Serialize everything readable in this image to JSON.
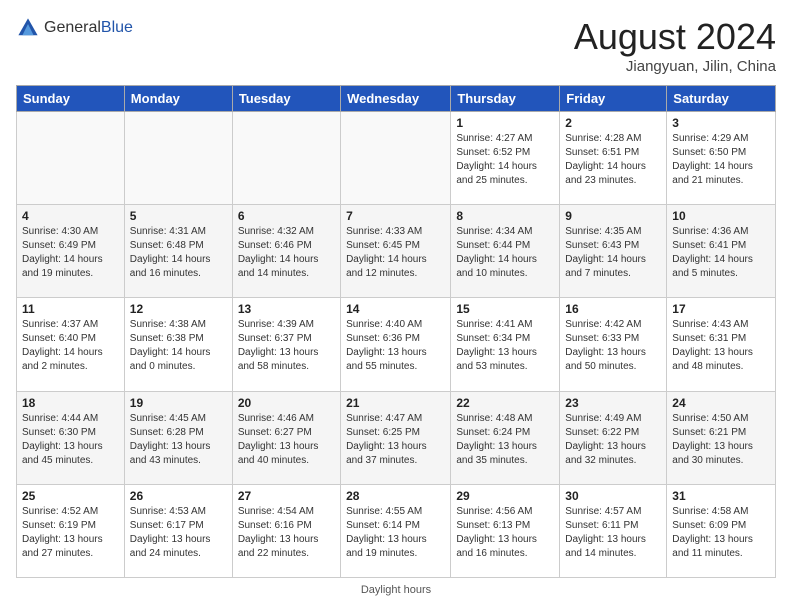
{
  "header": {
    "logo_general": "General",
    "logo_blue": "Blue",
    "title": "August 2024",
    "subtitle": "Jiangyuan, Jilin, China"
  },
  "days_of_week": [
    "Sunday",
    "Monday",
    "Tuesday",
    "Wednesday",
    "Thursday",
    "Friday",
    "Saturday"
  ],
  "weeks": [
    [
      {
        "day": "",
        "info": ""
      },
      {
        "day": "",
        "info": ""
      },
      {
        "day": "",
        "info": ""
      },
      {
        "day": "",
        "info": ""
      },
      {
        "day": "1",
        "info": "Sunrise: 4:27 AM\nSunset: 6:52 PM\nDaylight: 14 hours and 25 minutes."
      },
      {
        "day": "2",
        "info": "Sunrise: 4:28 AM\nSunset: 6:51 PM\nDaylight: 14 hours and 23 minutes."
      },
      {
        "day": "3",
        "info": "Sunrise: 4:29 AM\nSunset: 6:50 PM\nDaylight: 14 hours and 21 minutes."
      }
    ],
    [
      {
        "day": "4",
        "info": "Sunrise: 4:30 AM\nSunset: 6:49 PM\nDaylight: 14 hours and 19 minutes."
      },
      {
        "day": "5",
        "info": "Sunrise: 4:31 AM\nSunset: 6:48 PM\nDaylight: 14 hours and 16 minutes."
      },
      {
        "day": "6",
        "info": "Sunrise: 4:32 AM\nSunset: 6:46 PM\nDaylight: 14 hours and 14 minutes."
      },
      {
        "day": "7",
        "info": "Sunrise: 4:33 AM\nSunset: 6:45 PM\nDaylight: 14 hours and 12 minutes."
      },
      {
        "day": "8",
        "info": "Sunrise: 4:34 AM\nSunset: 6:44 PM\nDaylight: 14 hours and 10 minutes."
      },
      {
        "day": "9",
        "info": "Sunrise: 4:35 AM\nSunset: 6:43 PM\nDaylight: 14 hours and 7 minutes."
      },
      {
        "day": "10",
        "info": "Sunrise: 4:36 AM\nSunset: 6:41 PM\nDaylight: 14 hours and 5 minutes."
      }
    ],
    [
      {
        "day": "11",
        "info": "Sunrise: 4:37 AM\nSunset: 6:40 PM\nDaylight: 14 hours and 2 minutes."
      },
      {
        "day": "12",
        "info": "Sunrise: 4:38 AM\nSunset: 6:38 PM\nDaylight: 14 hours and 0 minutes."
      },
      {
        "day": "13",
        "info": "Sunrise: 4:39 AM\nSunset: 6:37 PM\nDaylight: 13 hours and 58 minutes."
      },
      {
        "day": "14",
        "info": "Sunrise: 4:40 AM\nSunset: 6:36 PM\nDaylight: 13 hours and 55 minutes."
      },
      {
        "day": "15",
        "info": "Sunrise: 4:41 AM\nSunset: 6:34 PM\nDaylight: 13 hours and 53 minutes."
      },
      {
        "day": "16",
        "info": "Sunrise: 4:42 AM\nSunset: 6:33 PM\nDaylight: 13 hours and 50 minutes."
      },
      {
        "day": "17",
        "info": "Sunrise: 4:43 AM\nSunset: 6:31 PM\nDaylight: 13 hours and 48 minutes."
      }
    ],
    [
      {
        "day": "18",
        "info": "Sunrise: 4:44 AM\nSunset: 6:30 PM\nDaylight: 13 hours and 45 minutes."
      },
      {
        "day": "19",
        "info": "Sunrise: 4:45 AM\nSunset: 6:28 PM\nDaylight: 13 hours and 43 minutes."
      },
      {
        "day": "20",
        "info": "Sunrise: 4:46 AM\nSunset: 6:27 PM\nDaylight: 13 hours and 40 minutes."
      },
      {
        "day": "21",
        "info": "Sunrise: 4:47 AM\nSunset: 6:25 PM\nDaylight: 13 hours and 37 minutes."
      },
      {
        "day": "22",
        "info": "Sunrise: 4:48 AM\nSunset: 6:24 PM\nDaylight: 13 hours and 35 minutes."
      },
      {
        "day": "23",
        "info": "Sunrise: 4:49 AM\nSunset: 6:22 PM\nDaylight: 13 hours and 32 minutes."
      },
      {
        "day": "24",
        "info": "Sunrise: 4:50 AM\nSunset: 6:21 PM\nDaylight: 13 hours and 30 minutes."
      }
    ],
    [
      {
        "day": "25",
        "info": "Sunrise: 4:52 AM\nSunset: 6:19 PM\nDaylight: 13 hours and 27 minutes."
      },
      {
        "day": "26",
        "info": "Sunrise: 4:53 AM\nSunset: 6:17 PM\nDaylight: 13 hours and 24 minutes."
      },
      {
        "day": "27",
        "info": "Sunrise: 4:54 AM\nSunset: 6:16 PM\nDaylight: 13 hours and 22 minutes."
      },
      {
        "day": "28",
        "info": "Sunrise: 4:55 AM\nSunset: 6:14 PM\nDaylight: 13 hours and 19 minutes."
      },
      {
        "day": "29",
        "info": "Sunrise: 4:56 AM\nSunset: 6:13 PM\nDaylight: 13 hours and 16 minutes."
      },
      {
        "day": "30",
        "info": "Sunrise: 4:57 AM\nSunset: 6:11 PM\nDaylight: 13 hours and 14 minutes."
      },
      {
        "day": "31",
        "info": "Sunrise: 4:58 AM\nSunset: 6:09 PM\nDaylight: 13 hours and 11 minutes."
      }
    ]
  ],
  "footer": "Daylight hours"
}
